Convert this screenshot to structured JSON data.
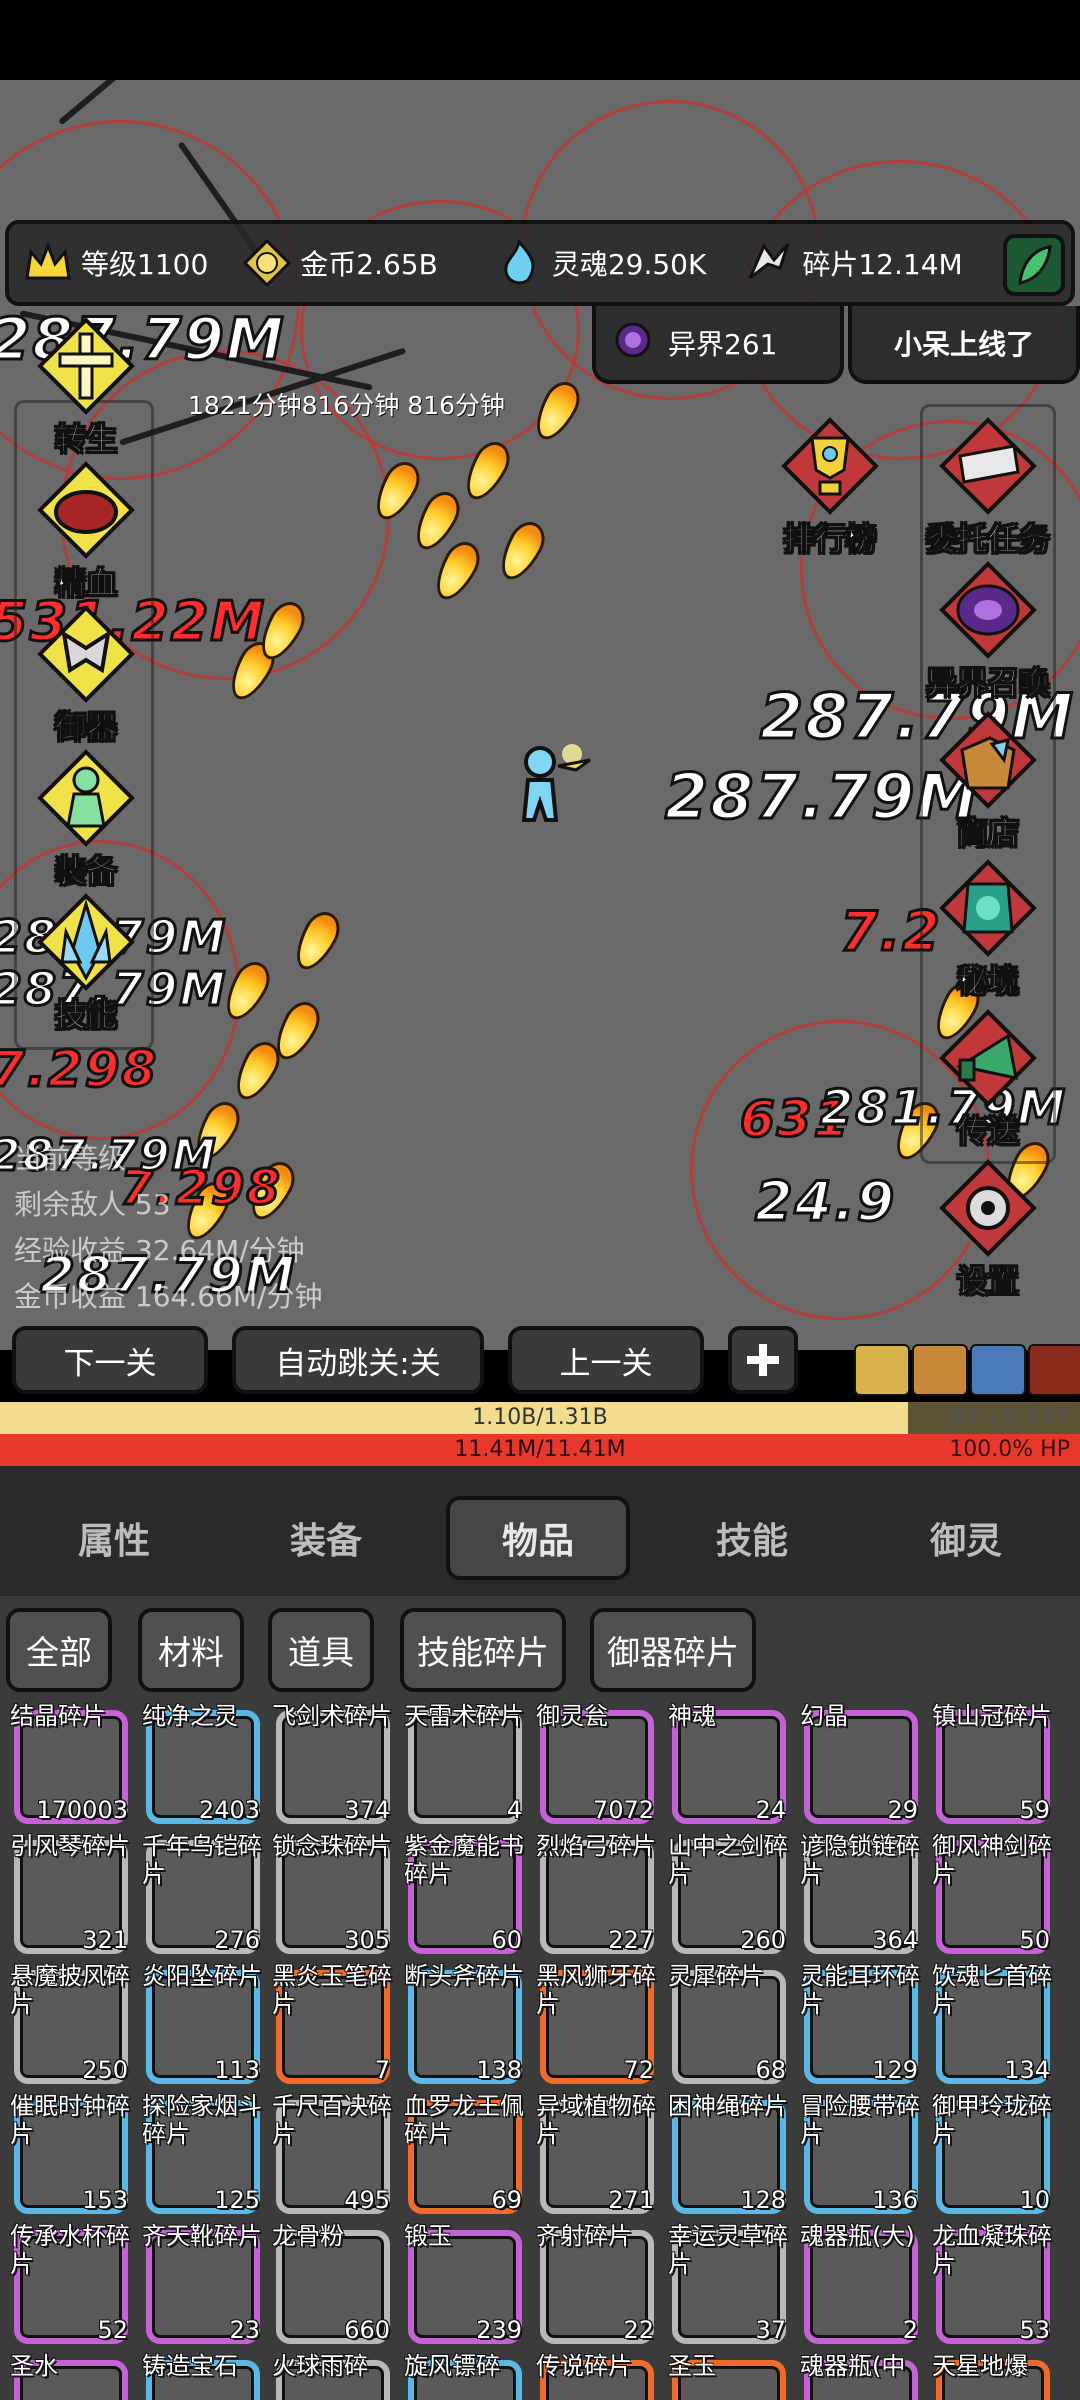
{
  "resources": {
    "level": "等级1100",
    "gold": "金币2.65B",
    "soul": "灵魂29.50K",
    "shard": "碎片12.14M"
  },
  "otherworld": "异界261",
  "online_notice": "小呆上线了",
  "time_readout": "1821分钟816分钟 816分钟",
  "left_menu": [
    "转生",
    "精血",
    "御器",
    "装备",
    "技能"
  ],
  "right_menu": {
    "ranking": "排行榜",
    "commission": "委托任务",
    "summon": "异界召唤",
    "shop": "商店",
    "realm": "秘境",
    "teleport": "传送",
    "settings": "设置"
  },
  "stats": {
    "current_level": "当前等级",
    "remaining_enemies": "剩余敌人    53",
    "exp_income": "经验收益    32.64M/分钟",
    "gold_income": "金币收益    164.66M/分钟"
  },
  "damage_numbers": [
    "287.79M",
    "287.79M",
    "287.79M",
    "287.79M",
    "287.79M",
    "287.79M",
    "287.79M",
    "531.22M",
    "7.298",
    "7.298",
    "7.2",
    "631",
    "24.9",
    "281.79M"
  ],
  "controls": {
    "next": "下一关",
    "auto": "自动跳关:关",
    "prev": "上一关"
  },
  "exp_bar": {
    "text": "1.10B/1.31B",
    "percent_label": "84.1% EXP",
    "fraction": 0.841
  },
  "hp_bar": {
    "text": "11.41M/11.41M",
    "percent_label": "100.0%  HP",
    "fraction": 1.0
  },
  "tabs": [
    {
      "label": "属性",
      "active": false
    },
    {
      "label": "装备",
      "active": false
    },
    {
      "label": "物品",
      "active": true
    },
    {
      "label": "技能",
      "active": false
    },
    {
      "label": "御灵",
      "active": false
    }
  ],
  "filters": [
    "全部",
    "材料",
    "道具",
    "技能碎片",
    "御器碎片"
  ],
  "items": [
    {
      "name": "结晶碎片",
      "count": "170003",
      "color": "#c462d6"
    },
    {
      "name": "纯净之灵",
      "count": "2403",
      "color": "#5ab8e6"
    },
    {
      "name": "飞剑术碎片",
      "count": "374",
      "color": "#b8b8b8"
    },
    {
      "name": "天雷术碎片",
      "count": "4",
      "color": "#b8b8b8"
    },
    {
      "name": "御灵瓮",
      "count": "7072",
      "color": "#c462d6"
    },
    {
      "name": "神魂",
      "count": "24",
      "color": "#c462d6"
    },
    {
      "name": "幻晶",
      "count": "29",
      "color": "#c462d6"
    },
    {
      "name": "镇山冠碎片",
      "count": "59",
      "color": "#c462d6"
    },
    {
      "name": "引风琴碎片",
      "count": "321",
      "color": "#b8b8b8"
    },
    {
      "name": "千年乌铠碎片",
      "count": "276",
      "color": "#b8b8b8"
    },
    {
      "name": "锁念珠碎片",
      "count": "305",
      "color": "#b8b8b8"
    },
    {
      "name": "紫金魔能书碎片",
      "count": "60",
      "color": "#c462d6"
    },
    {
      "name": "烈焰弓碎片",
      "count": "227",
      "color": "#b8b8b8"
    },
    {
      "name": "山中之剑碎片",
      "count": "260",
      "color": "#b8b8b8"
    },
    {
      "name": "谚隐锁链碎片",
      "count": "364",
      "color": "#b8b8b8"
    },
    {
      "name": "御风神剑碎片",
      "count": "50",
      "color": "#c462d6"
    },
    {
      "name": "悬魔披风碎片",
      "count": "250",
      "color": "#b8b8b8"
    },
    {
      "name": "炎阳坠碎片",
      "count": "113",
      "color": "#5ab8e6"
    },
    {
      "name": "黑炎玉笔碎片",
      "count": "7",
      "color": "#f06a2a"
    },
    {
      "name": "断头斧碎片",
      "count": "138",
      "color": "#5ab8e6"
    },
    {
      "name": "黑风狮牙碎片",
      "count": "72",
      "color": "#f06a2a"
    },
    {
      "name": "灵犀碎片",
      "count": "68",
      "color": "#b8b8b8"
    },
    {
      "name": "灵能耳环碎片",
      "count": "129",
      "color": "#5ab8e6"
    },
    {
      "name": "饮魂匕首碎片",
      "count": "134",
      "color": "#5ab8e6"
    },
    {
      "name": "催眠时钟碎片",
      "count": "153",
      "color": "#5ab8e6"
    },
    {
      "name": "探险家烟斗碎片",
      "count": "125",
      "color": "#5ab8e6"
    },
    {
      "name": "千尺百决碎片",
      "count": "495",
      "color": "#b8b8b8"
    },
    {
      "name": "血罗龙王佩碎片",
      "count": "69",
      "color": "#f06a2a"
    },
    {
      "name": "异域植物碎片",
      "count": "271",
      "color": "#b8b8b8"
    },
    {
      "name": "困神绳碎片",
      "count": "128",
      "color": "#5ab8e6"
    },
    {
      "name": "冒险腰带碎片",
      "count": "136",
      "color": "#5ab8e6"
    },
    {
      "name": "御甲玲珑碎片",
      "count": "10",
      "color": "#5ab8e6"
    },
    {
      "name": "传承水杯碎片",
      "count": "52",
      "color": "#c462d6"
    },
    {
      "name": "齐天靴碎片",
      "count": "23",
      "color": "#c462d6"
    },
    {
      "name": "龙骨粉",
      "count": "660",
      "color": "#b8b8b8"
    },
    {
      "name": "锻玉",
      "count": "239",
      "color": "#c462d6"
    },
    {
      "name": "齐射碎片",
      "count": "22",
      "color": "#b8b8b8"
    },
    {
      "name": "幸运灵草碎片",
      "count": "37",
      "color": "#b8b8b8"
    },
    {
      "name": "魂器瓶(大)",
      "count": "2",
      "color": "#c462d6"
    },
    {
      "name": "龙血凝珠碎片",
      "count": "53",
      "color": "#c462d6"
    },
    {
      "name": "圣水",
      "count": "",
      "color": "#c462d6"
    },
    {
      "name": "铸造宝石",
      "count": "",
      "color": "#5ab8e6"
    },
    {
      "name": "火球雨碎",
      "count": "",
      "color": "#b8b8b8"
    },
    {
      "name": "旋风镖碎",
      "count": "",
      "color": "#5ab8e6"
    },
    {
      "name": "传说碎片",
      "count": "",
      "color": "#f06a2a"
    },
    {
      "name": "圣玉",
      "count": "",
      "color": "#f06a2a"
    },
    {
      "name": "魂器瓶(中",
      "count": "",
      "color": "#c462d6"
    },
    {
      "name": "天星地爆",
      "count": "",
      "color": "#f06a2a"
    }
  ]
}
